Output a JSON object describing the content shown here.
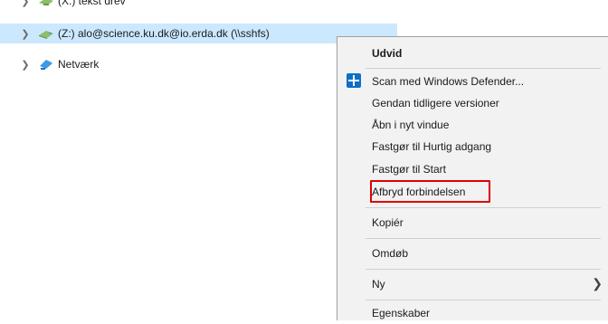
{
  "tree": {
    "partial_row_label": "(X:) tekst drev",
    "z_drive_label": "(Z:) alo@science.ku.dk@io.erda.dk (\\\\sshfs)",
    "network_label": "Netværk"
  },
  "icons": {
    "expand": "chevron-right-icon",
    "drive": "network-drive-icon",
    "network": "network-icon",
    "defender": "windows-defender-icon",
    "submenu": "chevron-right-icon"
  },
  "context_menu": {
    "items": [
      {
        "label": "Udvid",
        "bold": true
      },
      {
        "label": "Scan med Windows Defender..."
      },
      {
        "label": "Gendan tidligere versioner"
      },
      {
        "label": "Åbn i nyt vindue"
      },
      {
        "label": "Fastgør til Hurtig adgang"
      },
      {
        "label": "Fastgør til Start"
      },
      {
        "label": "Afbryd forbindelsen",
        "highlighted": true
      },
      {
        "label": "Kopiér"
      },
      {
        "label": "Omdøb"
      },
      {
        "label": "Ny",
        "has_submenu": true
      },
      {
        "label": "Egenskaber"
      }
    ]
  },
  "colors": {
    "selection": "#cce8ff",
    "menu_background": "#f2f2f2",
    "highlight_border": "#e10000"
  }
}
